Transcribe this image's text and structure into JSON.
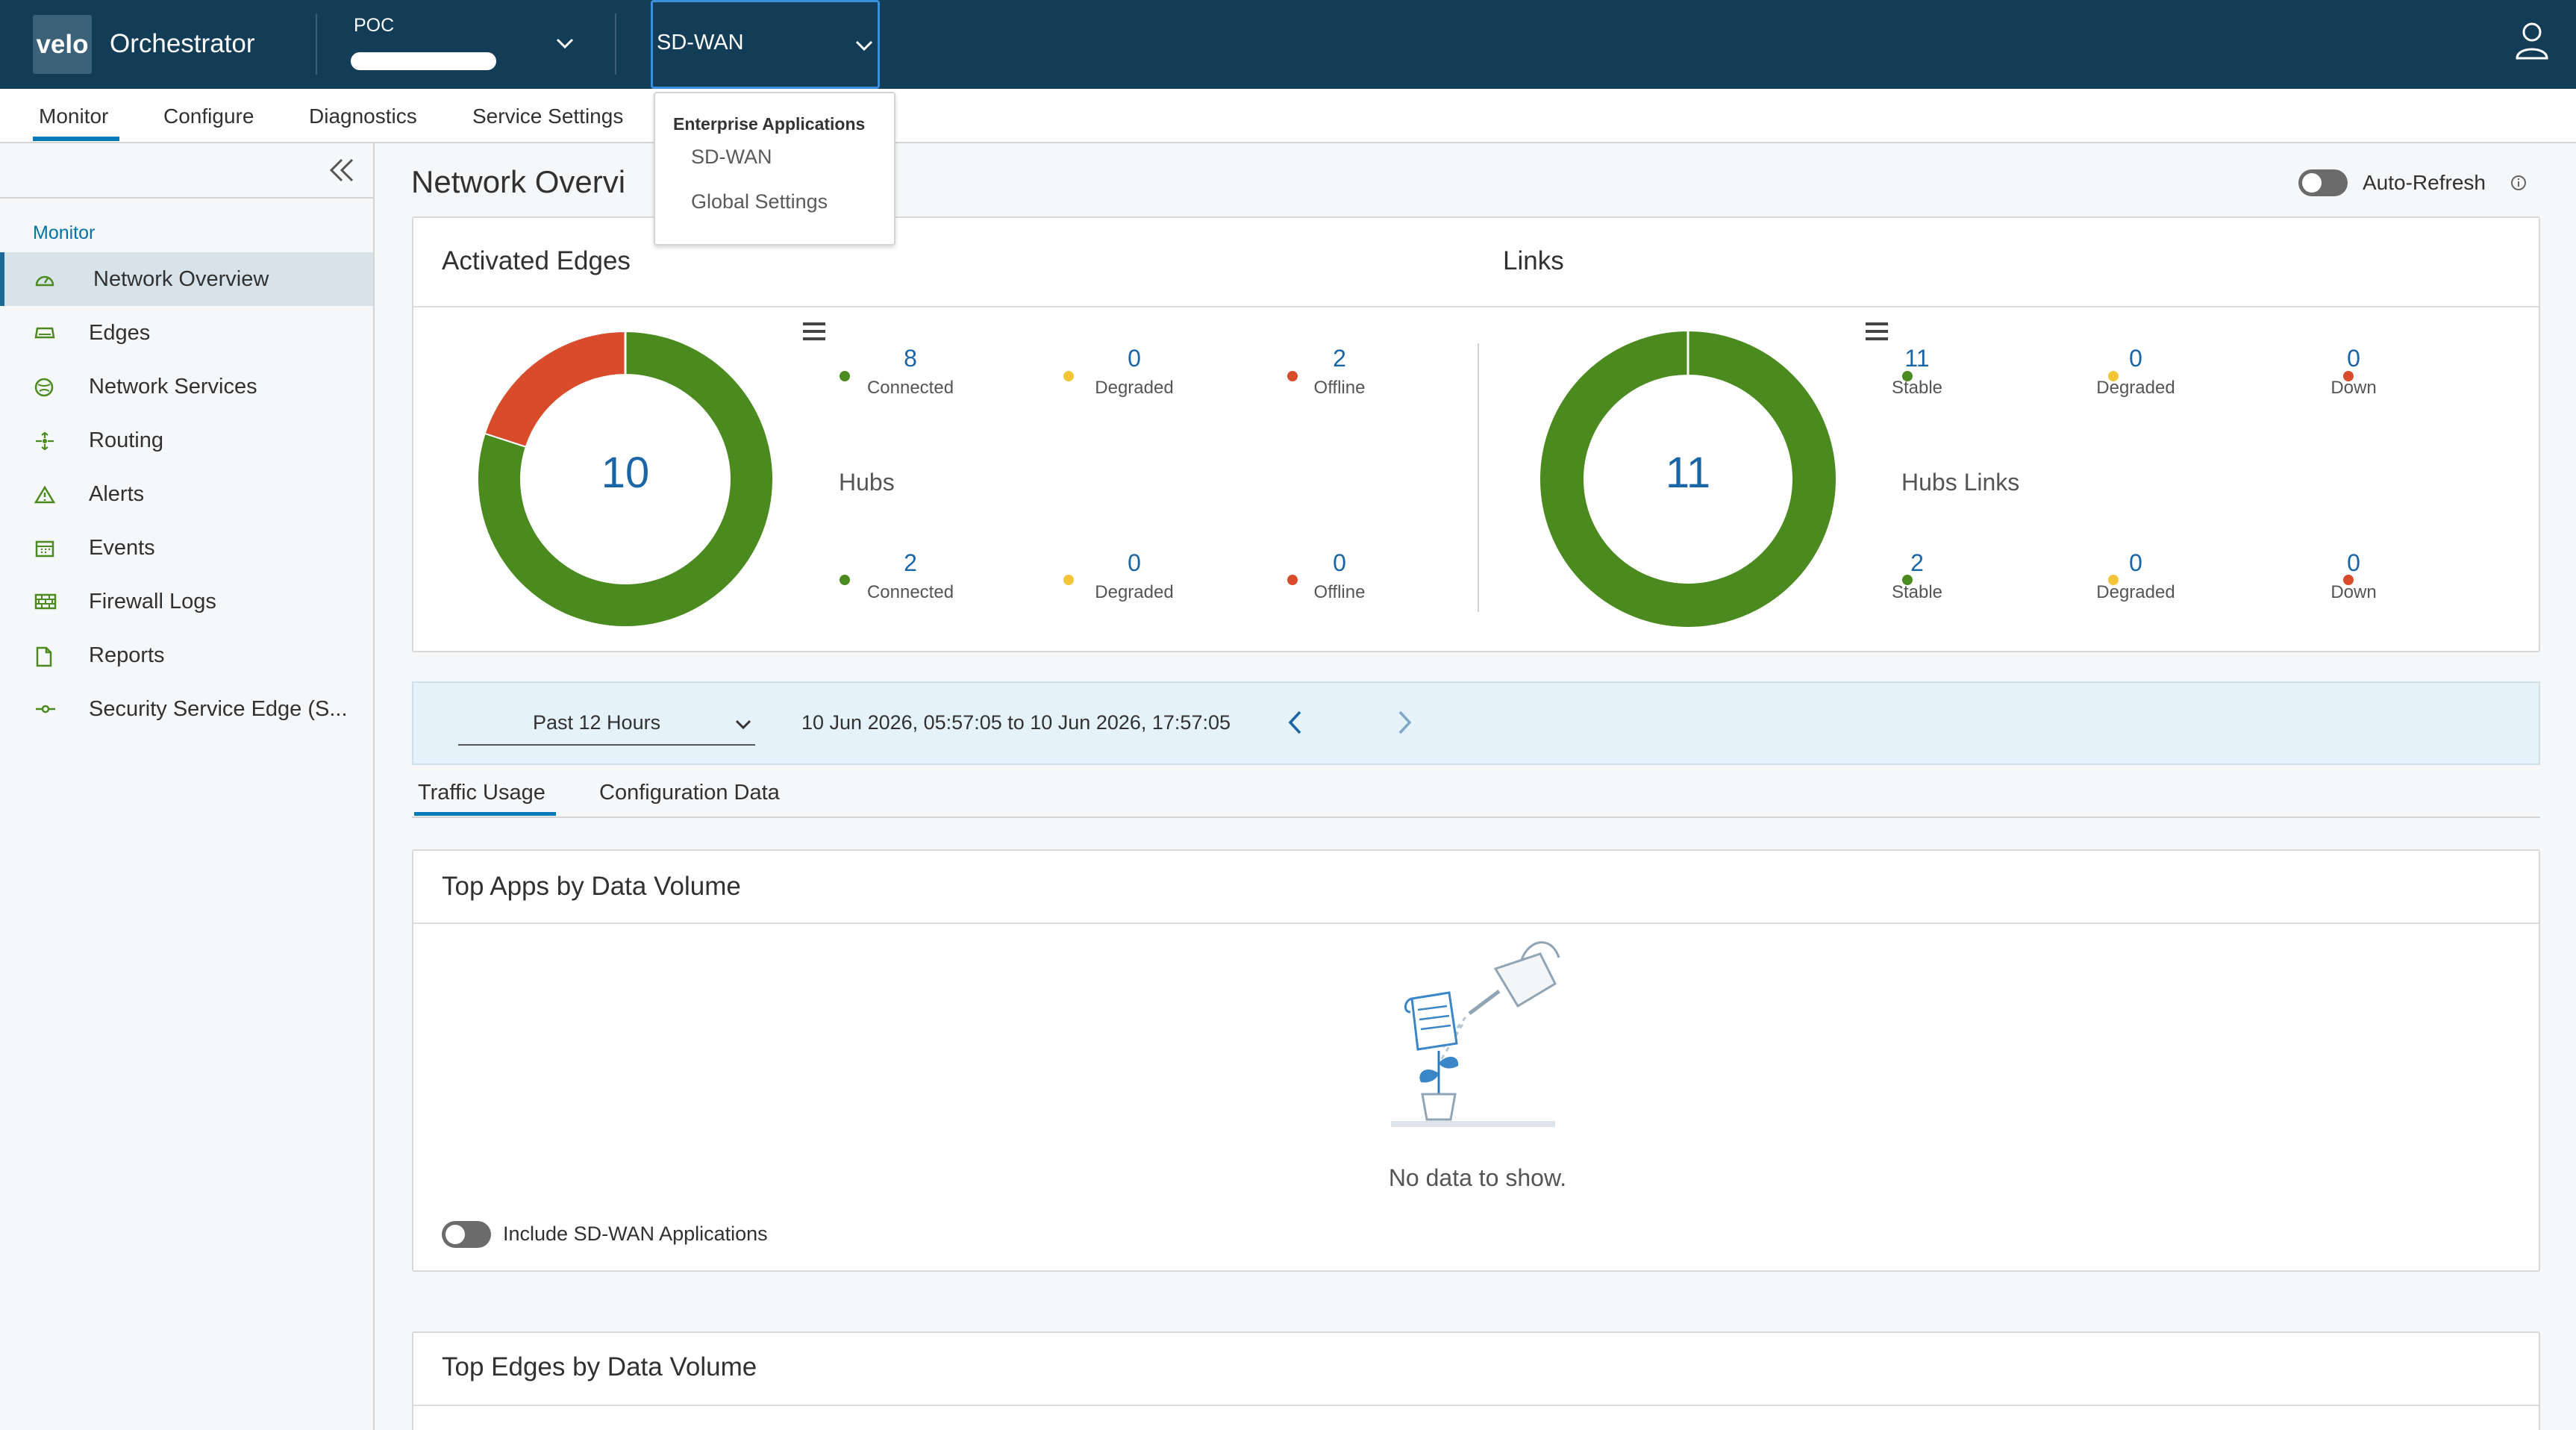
{
  "header": {
    "logo_text": "velo",
    "app_name": "Orchestrator",
    "customer_label": "POC",
    "app_selector": "SD-WAN"
  },
  "app_dropdown": {
    "heading": "Enterprise Applications",
    "items": [
      "SD-WAN",
      "Global Settings"
    ]
  },
  "tabs": [
    "Monitor",
    "Configure",
    "Diagnostics",
    "Service Settings"
  ],
  "sidebar": {
    "section": "Monitor",
    "items": [
      {
        "label": "Network Overview",
        "icon": "gauge-icon"
      },
      {
        "label": "Edges",
        "icon": "edge-device-icon"
      },
      {
        "label": "Network Services",
        "icon": "globe-icon"
      },
      {
        "label": "Routing",
        "icon": "routing-icon"
      },
      {
        "label": "Alerts",
        "icon": "alert-triangle-icon"
      },
      {
        "label": "Events",
        "icon": "calendar-icon"
      },
      {
        "label": "Firewall Logs",
        "icon": "firewall-icon"
      },
      {
        "label": "Reports",
        "icon": "document-icon"
      },
      {
        "label": "Security Service Edge (S...",
        "icon": "security-edge-icon"
      }
    ]
  },
  "page": {
    "title": "Network Overvi",
    "auto_refresh_label": "Auto-Refresh"
  },
  "summary": {
    "edges": {
      "title": "Activated Edges",
      "total": "10",
      "connected": "8",
      "connected_label": "Connected",
      "degraded": "0",
      "degraded_label": "Degraded",
      "offline": "2",
      "offline_label": "Offline",
      "hubs_title": "Hubs",
      "hubs_connected": "2",
      "hubs_connected_label": "Connected",
      "hubs_degraded": "0",
      "hubs_degraded_label": "Degraded",
      "hubs_offline": "0",
      "hubs_offline_label": "Offline"
    },
    "links": {
      "title": "Links",
      "total": "11",
      "stable": "11",
      "stable_label": "Stable",
      "degraded": "0",
      "degraded_label": "Degraded",
      "down": "0",
      "down_label": "Down",
      "hubs_title": "Hubs Links",
      "hubs_stable": "2",
      "hubs_stable_label": "Stable",
      "hubs_degraded": "0",
      "hubs_degraded_label": "Degraded",
      "hubs_down": "0",
      "hubs_down_label": "Down"
    }
  },
  "time_range": {
    "period": "Past 12 Hours",
    "range_text": "10 Jun 2026, 05:57:05 to 10 Jun 2026, 17:57:05"
  },
  "subtabs": [
    "Traffic Usage",
    "Configuration Data"
  ],
  "top_apps": {
    "title": "Top Apps by Data Volume",
    "empty_text": "No data to show.",
    "include_label": "Include SD-WAN Applications"
  },
  "top_edges": {
    "title": "Top Edges by Data Volume"
  },
  "colors": {
    "header_bg": "#133c56",
    "accent": "#0079b8",
    "connected": "#4a8a1e",
    "degraded": "#f3c536",
    "offline": "#d94c2b"
  },
  "chart_data": [
    {
      "type": "pie",
      "categories": [
        "Connected",
        "Degraded",
        "Offline"
      ],
      "values": [
        8,
        0,
        2
      ]
    },
    {
      "type": "pie",
      "categories": [
        "Stable",
        "Degraded",
        "Down"
      ],
      "values": [
        11,
        0,
        0
      ]
    }
  ]
}
